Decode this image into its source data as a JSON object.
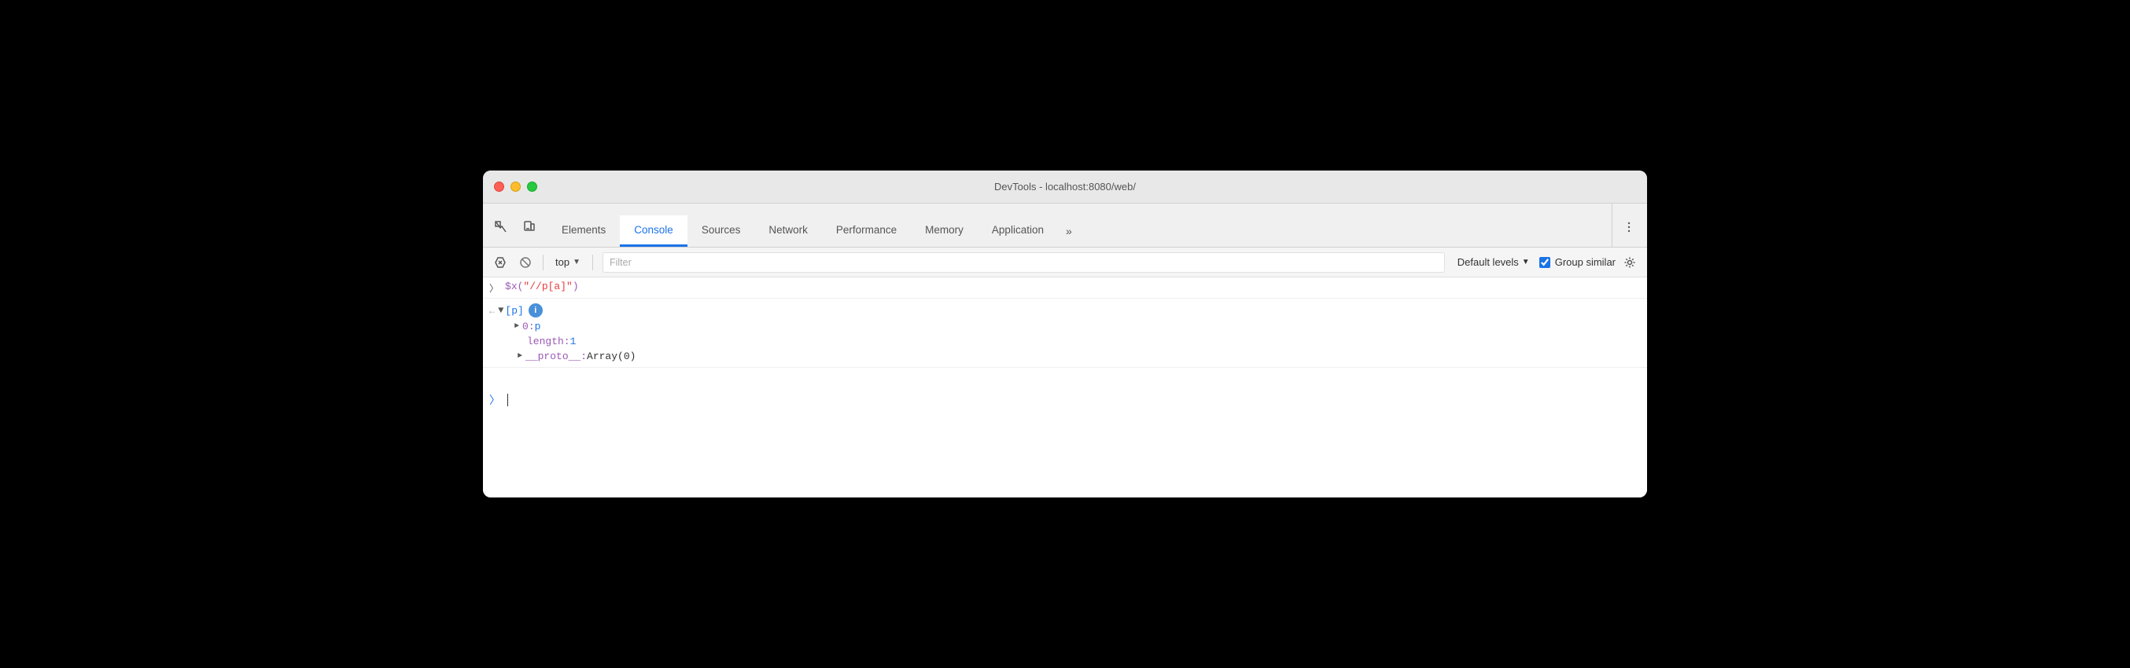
{
  "window": {
    "title": "DevTools - localhost:8080/web/"
  },
  "tabs": {
    "items": [
      {
        "id": "elements",
        "label": "Elements",
        "active": false
      },
      {
        "id": "console",
        "label": "Console",
        "active": true
      },
      {
        "id": "sources",
        "label": "Sources",
        "active": false
      },
      {
        "id": "network",
        "label": "Network",
        "active": false
      },
      {
        "id": "performance",
        "label": "Performance",
        "active": false
      },
      {
        "id": "memory",
        "label": "Memory",
        "active": false
      },
      {
        "id": "application",
        "label": "Application",
        "active": false
      }
    ],
    "more_label": "»"
  },
  "console_toolbar": {
    "context": "top",
    "filter_placeholder": "Filter",
    "levels_label": "Default levels",
    "group_similar_label": "Group similar",
    "group_similar_checked": true
  },
  "console_content": {
    "input_command": "$x(\"//p[a]\")",
    "output": {
      "array_label": "[p]",
      "item_0": "0: p",
      "length": "length:",
      "length_val": "1",
      "proto": "__proto__:",
      "proto_val": "Array(0)"
    }
  }
}
